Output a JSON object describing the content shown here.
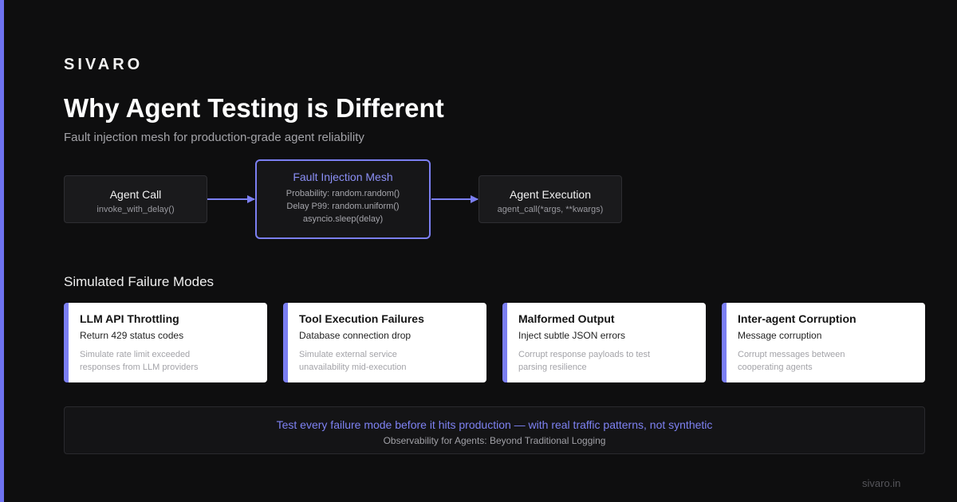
{
  "brand": "SIVARO",
  "title": "Why Agent Testing is Different",
  "subtitle": "Fault injection mesh for production-grade agent reliability",
  "colors": {
    "background": "#0e0e0f",
    "accent": "#7b7ff2",
    "card_background": "#ffffff",
    "node_background": "#1a1a1c"
  },
  "flow": {
    "agent_call": {
      "title": "Agent Call",
      "code": "invoke_with_delay()"
    },
    "mesh": {
      "title": "Fault Injection Mesh",
      "lines": [
        "Probability: random.random()",
        "Delay P99: random.uniform()",
        "asyncio.sleep(delay)"
      ]
    },
    "agent_execution": {
      "title": "Agent Execution",
      "code": "agent_call(*args, **kwargs)"
    }
  },
  "failure_modes": {
    "heading": "Simulated Failure Modes",
    "cards": [
      {
        "title": "LLM API Throttling",
        "subtitle": "Return 429 status codes",
        "description": "Simulate rate limit exceeded responses from LLM providers"
      },
      {
        "title": "Tool Execution Failures",
        "subtitle": "Database connection drop",
        "description": "Simulate external service unavailability mid-execution"
      },
      {
        "title": "Malformed Output",
        "subtitle": "Inject subtle JSON errors",
        "description": "Corrupt response payloads to test parsing resilience"
      },
      {
        "title": "Inter-agent Corruption",
        "subtitle": "Message corruption",
        "description": "Corrupt messages between cooperating agents"
      }
    ]
  },
  "footer": {
    "main": "Test every failure mode before it hits production — with real traffic patterns, not synthetic",
    "sub": "Observability for Agents: Beyond Traditional Logging"
  },
  "site": "sivaro.in"
}
